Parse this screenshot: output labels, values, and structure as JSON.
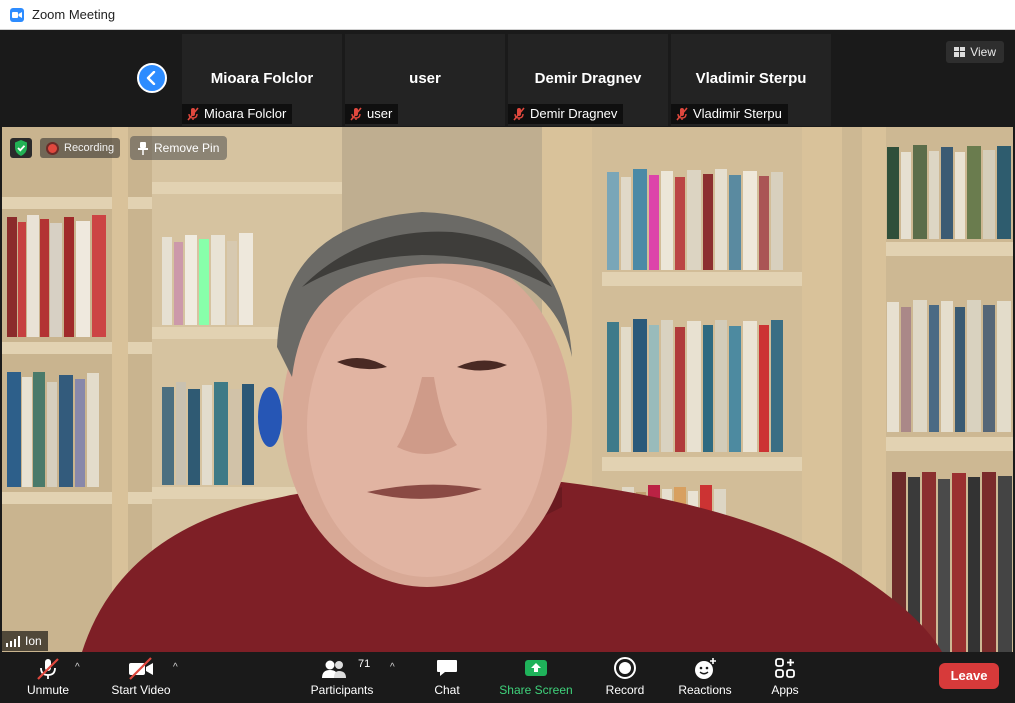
{
  "window": {
    "title": "Zoom Meeting",
    "icon": "zoom-camera-icon"
  },
  "strip": {
    "participants": [
      {
        "name": "Mioara Folclor",
        "label": "Mioara Folclor",
        "muted": true
      },
      {
        "name": "user",
        "label": "user",
        "muted": true
      },
      {
        "name": "Demir Dragnev",
        "label": "Demir Dragnev",
        "muted": true
      },
      {
        "name": "Vladimir Sterpu",
        "label": "Vladimir Sterpu",
        "muted": true
      }
    ],
    "view_label": "View"
  },
  "main_video": {
    "speaker_name": "Ion",
    "recording_label": "Recording",
    "remove_pin_label": "Remove Pin"
  },
  "toolbar": {
    "unmute": "Unmute",
    "start_video": "Start Video",
    "participants": "Participants",
    "participants_count": "71",
    "chat": "Chat",
    "share_screen": "Share Screen",
    "record": "Record",
    "reactions": "Reactions",
    "apps": "Apps",
    "leave": "Leave"
  },
  "colors": {
    "accent": "#2d8cff",
    "share_green": "#1fb25a",
    "leave_red": "#d73a3a",
    "muted_red": "#e0483e",
    "security_green": "#22b255"
  }
}
